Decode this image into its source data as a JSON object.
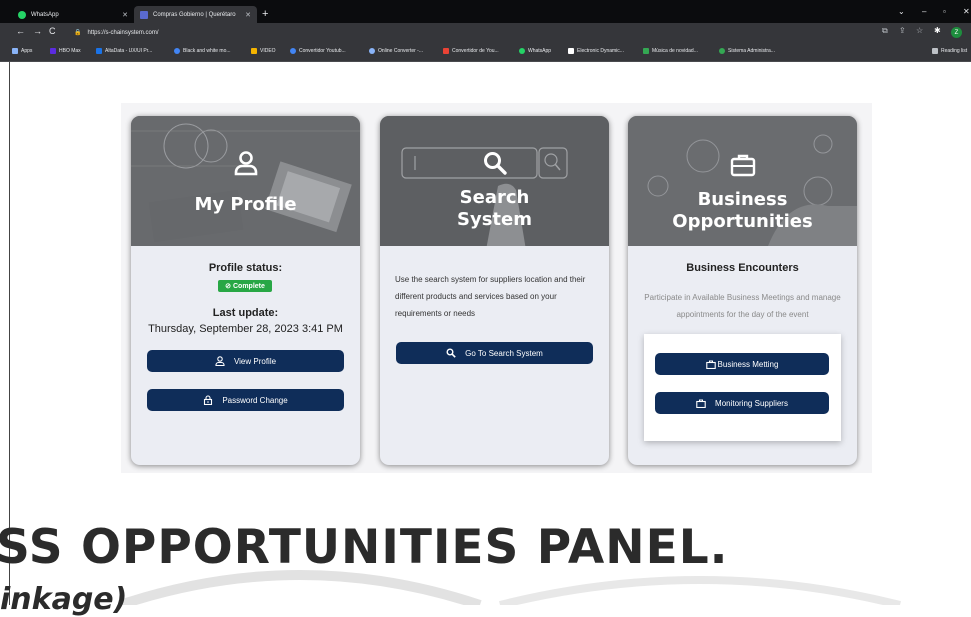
{
  "browser": {
    "tabs": [
      {
        "label": "WhatsApp",
        "active": false
      },
      {
        "label": "Compras Gobierno | Querétaro",
        "active": true
      }
    ],
    "url": "https://s-chainsystem.com/",
    "bookmarks": [
      "Apps",
      "HBO Max",
      "AltaData - UX/UI Pr...",
      "Black and white mo...",
      "VIDEO",
      "Convertidor Youtub...",
      "Online Converter -...",
      "Convertidor de You...",
      "WhatsApp",
      "Electronic Dynamic...",
      "Música de novidad...",
      "Sistema Administra...",
      "Reading list"
    ],
    "profile_initial": "Z"
  },
  "cards": {
    "profile": {
      "title": "My Profile",
      "status_label": "Profile status:",
      "status_value": "Complete",
      "update_label": "Last update:",
      "update_value": "Thursday, September 28, 2023 3:41 PM",
      "view_button": "View Profile",
      "password_button": "Password Change"
    },
    "search": {
      "title_line1": "Search",
      "title_line2": "System",
      "description": "Use the search system for suppliers location and their different products and services based on your requirements or needs",
      "button": "Go To Search System"
    },
    "business": {
      "title_line1": "Business",
      "title_line2": "Opportunities",
      "subtitle": "Business Encounters",
      "description": "Participate in Available Business Meetings and manage appointments for the day of the event",
      "meeting_button": "Business Metting",
      "monitoring_button": "Monitoring Suppliers"
    }
  },
  "overlay": {
    "heading": "SS OPPORTUNITIES PANEL.",
    "subheading": "inkage)"
  },
  "colors": {
    "button_navy": "#0f2d59",
    "status_green": "#28a745"
  }
}
